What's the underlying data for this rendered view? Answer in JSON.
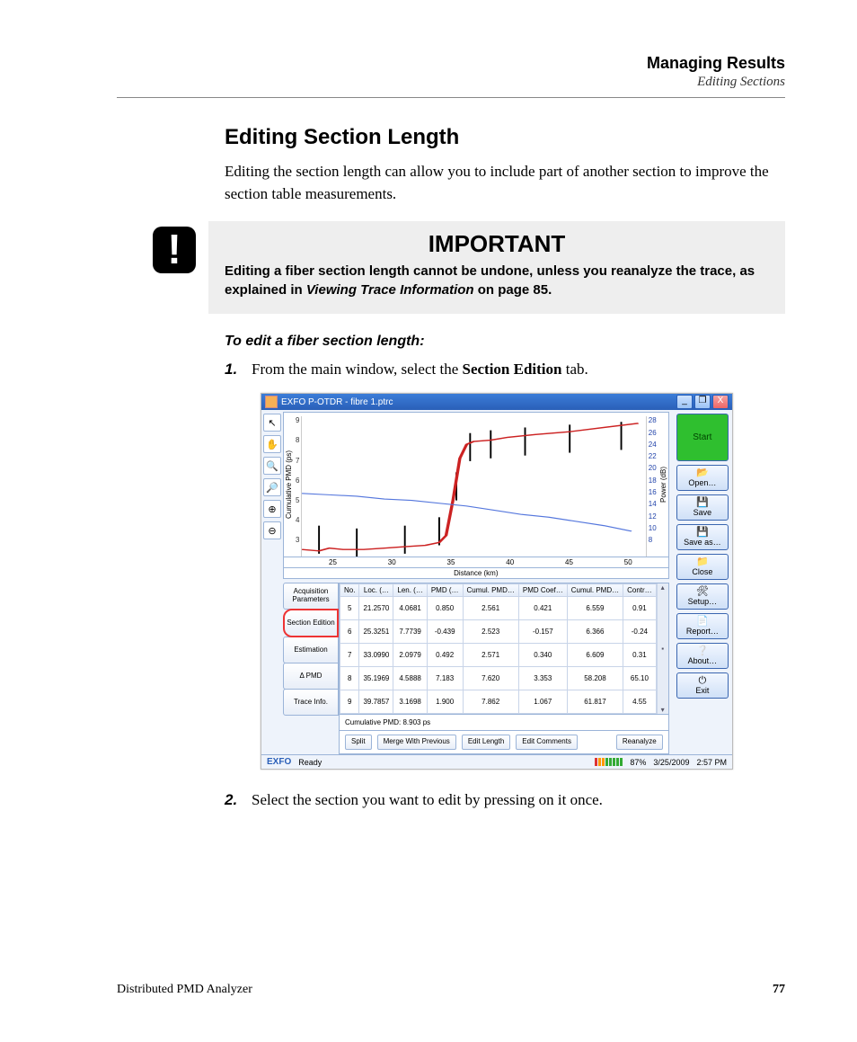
{
  "header": {
    "title": "Managing Results",
    "subtitle": "Editing Sections"
  },
  "h2": "Editing Section Length",
  "intro": "Editing the section length can allow you to include part of another section to improve the section table measurements.",
  "important": {
    "title": "IMPORTANT",
    "line1": "Editing a fiber section length cannot be undone, unless you reanalyze the trace, as explained in ",
    "ital": "Viewing Trace Information",
    "line2": " on page 85."
  },
  "procHead": "To edit a fiber section length:",
  "steps": {
    "s1": {
      "num": "1.",
      "pre": "From the main window, select the ",
      "bold": "Section Edition",
      "post": " tab."
    },
    "s2": {
      "num": "2.",
      "text": "Select the section you want to edit by pressing on it once."
    }
  },
  "shot": {
    "title": "EXFO P-OTDR - fibre 1.ptrc",
    "winbtns": {
      "min": "_",
      "max": "❐",
      "close": "X"
    },
    "tools": [
      "↖",
      "✋",
      "🔍",
      "🔎",
      "⊕",
      "⊖"
    ],
    "leftYLabel": "Cumulative PMD (ps)",
    "rightYLabel": "Power (dB)",
    "leftTicks": [
      "9",
      "8",
      "7",
      "6",
      "5",
      "4",
      "3"
    ],
    "rightTicks": [
      "28",
      "26",
      "24",
      "22",
      "20",
      "18",
      "16",
      "14",
      "12",
      "10",
      "8"
    ],
    "xTicks": [
      "25",
      "30",
      "35",
      "40",
      "45",
      "50"
    ],
    "xLabel": "Distance (km)",
    "vtabs": [
      "Acquisition Parameters",
      "Section Edition",
      "Estimation",
      "Δ PMD",
      "Trace Info."
    ],
    "selectedTab": 1,
    "tableHeaders": [
      "No.",
      "Loc. (…",
      "Len. (…",
      "PMD (…",
      "Cumul. PMD…",
      "PMD Coef…",
      "Cumul. PMD…",
      "Contr…"
    ],
    "tableRows": [
      [
        "5",
        "21.2570",
        "4.0681",
        "0.850",
        "2.561",
        "0.421",
        "6.559",
        "0.91"
      ],
      [
        "6",
        "25.3251",
        "7.7739",
        "-0.439",
        "2.523",
        "-0.157",
        "6.366",
        "-0.24"
      ],
      [
        "7",
        "33.0990",
        "2.0979",
        "0.492",
        "2.571",
        "0.340",
        "6.609",
        "0.31"
      ],
      [
        "8",
        "35.1969",
        "4.5888",
        "7.183",
        "7.620",
        "3.353",
        "58.208",
        "65.10"
      ],
      [
        "9",
        "39.7857",
        "3.1698",
        "1.900",
        "7.862",
        "1.067",
        "61.817",
        "4.55"
      ]
    ],
    "cumLabel": "Cumulative PMD: 8.903 ps",
    "bottomButtons": [
      "Split",
      "Merge With Previous",
      "Edit Length",
      "Edit Comments"
    ],
    "reanalyze": "Reanalyze",
    "rightButtons": {
      "start": "Start",
      "open": "Open…",
      "save": "Save",
      "saveas": "Save as…",
      "close": "Close",
      "setup": "Setup…",
      "report": "Report…",
      "about": "About…",
      "exit": "Exit"
    },
    "status": {
      "brand": "EXFO",
      "ready": "Ready",
      "pct": "87%",
      "date": "3/25/2009",
      "time": "2:57 PM"
    }
  },
  "chart_data": {
    "type": "line",
    "title": "",
    "xlabel": "Distance (km)",
    "ylabel_left": "Cumulative PMD (ps)",
    "ylabel_right": "Power (dB)",
    "xlim": [
      22,
      54
    ],
    "ylim_left": [
      3,
      9
    ],
    "ylim_right": [
      8,
      28
    ],
    "series": [
      {
        "name": "Cumulative PMD (ps)",
        "axis": "left",
        "color": "#cc2222",
        "x": [
          22,
          25,
          28,
          31,
          33,
          34,
          35,
          36,
          37,
          38,
          39,
          40,
          42,
          45,
          48,
          51,
          54
        ],
        "y": [
          3.2,
          3.1,
          3.2,
          3.2,
          3.3,
          3.3,
          3.4,
          5.0,
          7.5,
          7.7,
          7.8,
          7.8,
          7.9,
          8.0,
          8.2,
          8.6,
          8.8
        ]
      },
      {
        "name": "Power (dB)",
        "axis": "right",
        "color": "#5577dd",
        "x": [
          22,
          25,
          28,
          31,
          34,
          37,
          40,
          43,
          46,
          49,
          52,
          54
        ],
        "y": [
          16,
          15,
          14.5,
          14,
          13.5,
          13,
          12.5,
          11.5,
          11,
          10.5,
          10,
          9
        ]
      }
    ],
    "markers_x": [
      23.5,
      27,
      31.5,
      35,
      36.5,
      38,
      40,
      43,
      47,
      52
    ]
  },
  "footer": {
    "left": "Distributed PMD Analyzer",
    "page": "77"
  }
}
